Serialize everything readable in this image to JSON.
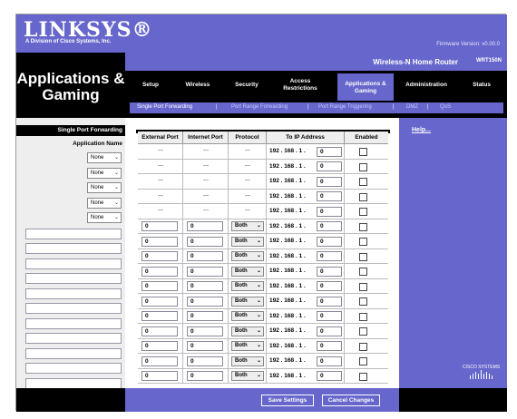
{
  "header": {
    "logo": "LINKSYS®",
    "logo_sub": "A Division of Cisco Systems, Inc.",
    "firmware": "Firmware Version: v0.00.0"
  },
  "title": {
    "line1": "Applications &",
    "line2": "Gaming"
  },
  "product": {
    "name": "Wireless-N Home Router",
    "model": "WRT150N"
  },
  "tabs": [
    {
      "label": "Setup"
    },
    {
      "label": "Wireless"
    },
    {
      "label": "Security"
    },
    {
      "label": "Access\nRestrictions"
    },
    {
      "label": "Applications &\nGaming"
    },
    {
      "label": "Administration"
    },
    {
      "label": "Status"
    }
  ],
  "subtabs": [
    {
      "label": "Single Port Forwarding"
    },
    {
      "label": "Port Range Forwarding"
    },
    {
      "label": "Port Range Triggering"
    },
    {
      "label": "DMZ"
    },
    {
      "label": "QoS"
    }
  ],
  "left": {
    "section": "Single Port Forwarding",
    "app_label": "Application Name",
    "select_value": "None"
  },
  "table": {
    "headers": [
      "External Port",
      "Internet Port",
      "Protocol",
      "To IP Address",
      "Enabled"
    ],
    "dash": "---",
    "ip_prefix": "192 . 168 . 1 .",
    "last_octet": "0",
    "port_value": "0",
    "protocol_value": "Both"
  },
  "right": {
    "help": "Help...",
    "logo": "CISCO SYSTEMS"
  },
  "footer": {
    "save": "Save Settings",
    "cancel": "Cancel Changes"
  },
  "colors": {
    "brand": "#6666cc"
  }
}
